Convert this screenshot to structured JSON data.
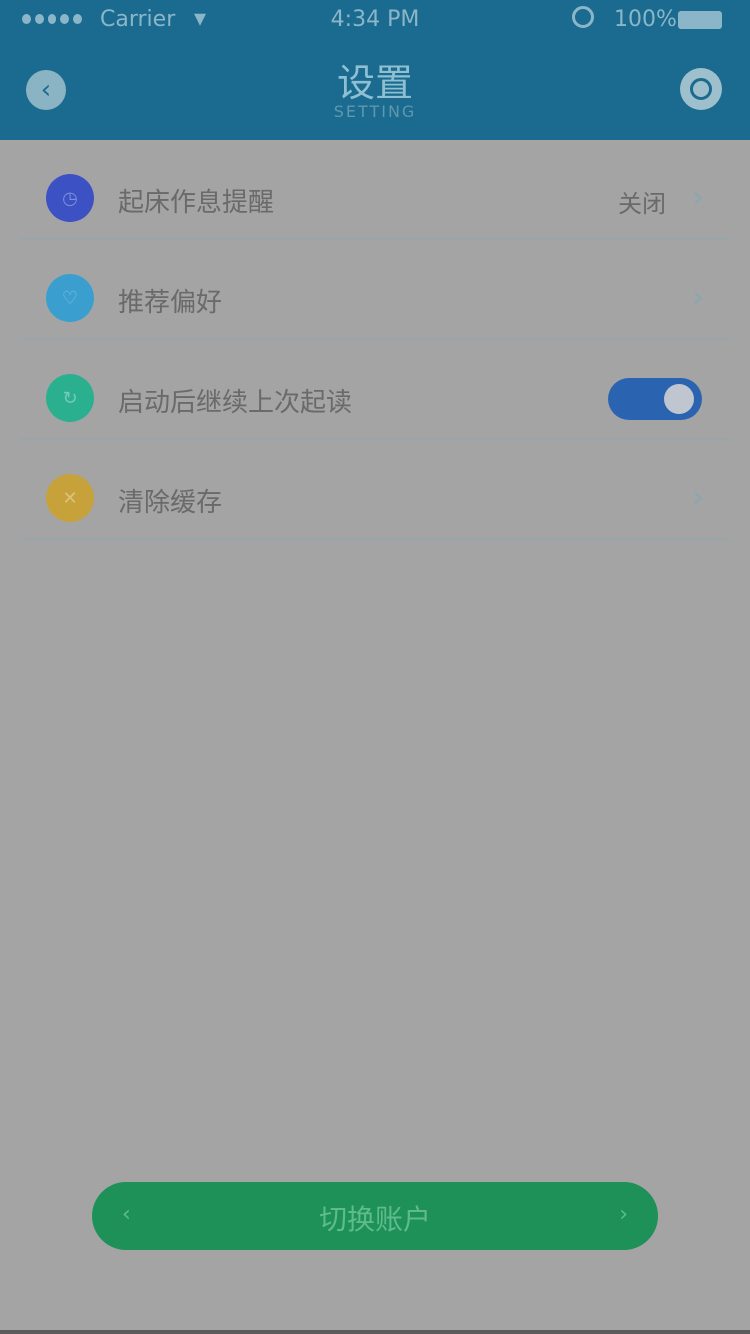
{
  "status_bar": {
    "carrier": "Carrier",
    "time": "4:34 PM",
    "battery_pct": "100%"
  },
  "nav": {
    "title": "设置",
    "subtitle": "SETTING",
    "back_icon": "back-arrow-icon",
    "right_icon": "settings-icon"
  },
  "settings": {
    "items": [
      {
        "label": "起床作息提醒",
        "value": "关闭",
        "icon": "alarm-icon",
        "icon_color": "#3c52c4",
        "control": "chevron"
      },
      {
        "label": "推荐偏好",
        "value": "",
        "icon": "like-icon",
        "icon_color": "#3a9fcf",
        "control": "chevron"
      },
      {
        "label": "启动后继续上次起读",
        "value": "",
        "icon": "history-icon",
        "icon_color": "#2bb08f",
        "control": "toggle",
        "toggle_on": true
      },
      {
        "label": "清除缓存",
        "value": "",
        "icon": "trash-icon",
        "icon_color": "#c7a23a",
        "control": "chevron"
      }
    ]
  },
  "footer": {
    "switch_account_label": "切换账户",
    "left_arrow": "‹",
    "right_arrow": "›"
  }
}
